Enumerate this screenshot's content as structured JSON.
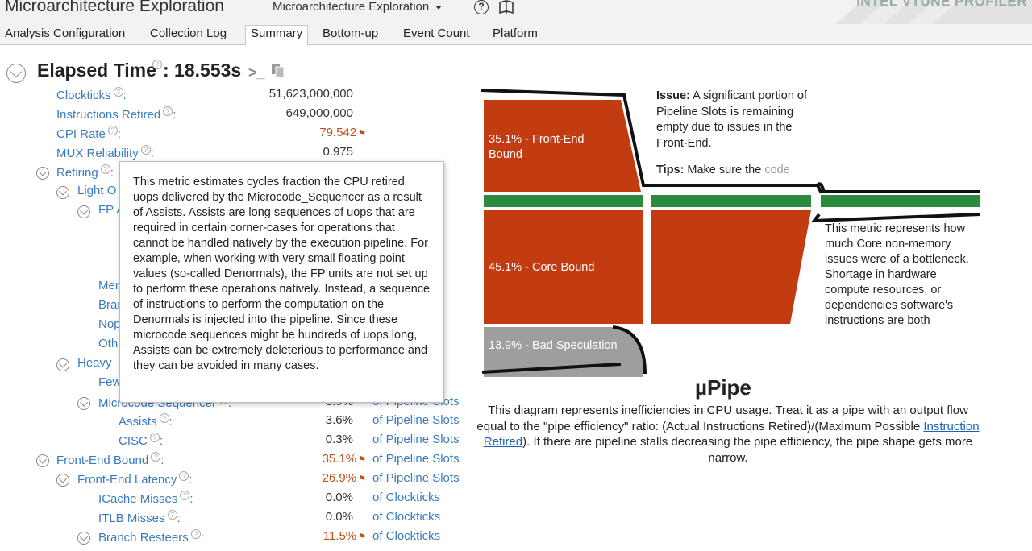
{
  "header": {
    "app_title": "Microarchitecture Exploration",
    "view_select": "Microarchitecture Exploration",
    "brand": "INTEL VTUNE PROFILER"
  },
  "tabs": [
    {
      "label": "Analysis Configuration",
      "active": false
    },
    {
      "label": "Collection Log",
      "active": false
    },
    {
      "label": "Summary",
      "active": true
    },
    {
      "label": "Bottom-up",
      "active": false
    },
    {
      "label": "Event Count",
      "active": false
    },
    {
      "label": "Platform",
      "active": false
    }
  ],
  "summary": {
    "elapsed_label": "Elapsed Time",
    "elapsed_value": ": 18.553s",
    "metrics": [
      {
        "name": "Clockticks",
        "colon": ":",
        "value": "51,623,000,000",
        "unit": ""
      },
      {
        "name": "Instructions Retired",
        "colon": ":",
        "value": "649,000,000",
        "unit": ""
      },
      {
        "name": "CPI Rate",
        "colon": ":",
        "value": "79.542",
        "flag": true,
        "unit": ""
      },
      {
        "name": "MUX Reliability",
        "colon": ":",
        "value": "0.975",
        "unit": ""
      },
      {
        "name": "Retiring",
        "colon": ":",
        "value": "",
        "unit": "ots"
      },
      {
        "name": "Light O",
        "colon": "",
        "value": "",
        "unit": "ots"
      },
      {
        "name": "FP A",
        "colon": "",
        "value": "",
        "unit": ""
      },
      {
        "name": "",
        "colon": "",
        "value": "",
        "unit": ""
      },
      {
        "name": "Mem",
        "colon": "",
        "value": "",
        "unit": "ots"
      },
      {
        "name": "Bran",
        "colon": "",
        "value": "",
        "unit": "ots"
      },
      {
        "name": "Nop",
        "colon": "",
        "value": "",
        "unit": "ots"
      },
      {
        "name": "Oth",
        "colon": "",
        "value": "",
        "unit": "ots"
      },
      {
        "name": "Heavy",
        "colon": "",
        "value": "",
        "unit": "ots"
      },
      {
        "name": "Few",
        "colon": "",
        "value": "",
        "unit": "ots"
      },
      {
        "name": "Microcode Sequencer",
        "colon": ":",
        "value": "3.9%",
        "unit": "of Pipeline Slots"
      },
      {
        "name": "Assists",
        "colon": ":",
        "value": "3.6%",
        "unit": "of Pipeline Slots"
      },
      {
        "name": "CISC",
        "colon": ":",
        "value": "0.3%",
        "unit": "of Pipeline Slots"
      },
      {
        "name": "Front-End Bound",
        "colon": ":",
        "value": "35.1%",
        "flag": true,
        "unit": "of Pipeline Slots"
      },
      {
        "name": "Front-End Latency",
        "colon": ":",
        "value": "26.9%",
        "flag": true,
        "unit": "of Pipeline Slots"
      },
      {
        "name": "ICache Misses",
        "colon": ":",
        "value": "0.0%",
        "unit": "of Clockticks"
      },
      {
        "name": "ITLB Misses",
        "colon": ":",
        "value": "0.0%",
        "unit": "of Clockticks"
      },
      {
        "name": "Branch Resteers",
        "colon": ":",
        "value": "11.5%",
        "flag": true,
        "unit": "of Clockticks"
      }
    ]
  },
  "tooltip": {
    "text": "This metric estimates cycles fraction the CPU retired uops delivered by the Microcode_Sequencer as a result of Assists. Assists are long sequences of uops that are required in certain corner-cases for operations that cannot be handled natively by the execution pipeline. For example, when working with very small floating point values (so-called Denormals), the FP units are not set up to perform these operations natively. Instead, a sequence of instructions to perform the computation on the Denormals is injected into the pipeline. Since these microcode sequences might be hundreds of uops long, Assists can be extremely deleterious to performance and they can be avoided in many cases."
  },
  "pipe": {
    "front_end_label": "35.1% - Front-End",
    "front_end_label2": "Bound",
    "core_label": "45.1% - Core Bound",
    "bad_spec_label": "13.9% - Bad Speculation",
    "colors": {
      "bottleneck": "#c33b10",
      "retiring": "#2b8a3e",
      "bad_spec": "#9e9e9e"
    },
    "issue_label": "Issue:",
    "issue_text": " A significant portion of Pipeline Slots is remaining empty due to issues in the Front-End.",
    "tips_label": "Tips:",
    "tips_text": " Make sure the ",
    "tips_fade": "code",
    "core_text": "This metric represents how much Core non-memory issues were of a bottleneck. Shortage in hardware compute resources, or dependencies software's instructions are both",
    "title": "µPipe",
    "desc_part1": "This diagram represents inefficiencies in CPU usage. Treat it as a pipe with an output flow equal to the \"pipe efficiency\" ratio: (Actual Instructions Retired)/(Maximum Possible ",
    "desc_link": "Instruction Retired",
    "desc_part2": "). If there are pipeline stalls decreasing the pipe efficiency, the pipe shape gets more narrow."
  }
}
